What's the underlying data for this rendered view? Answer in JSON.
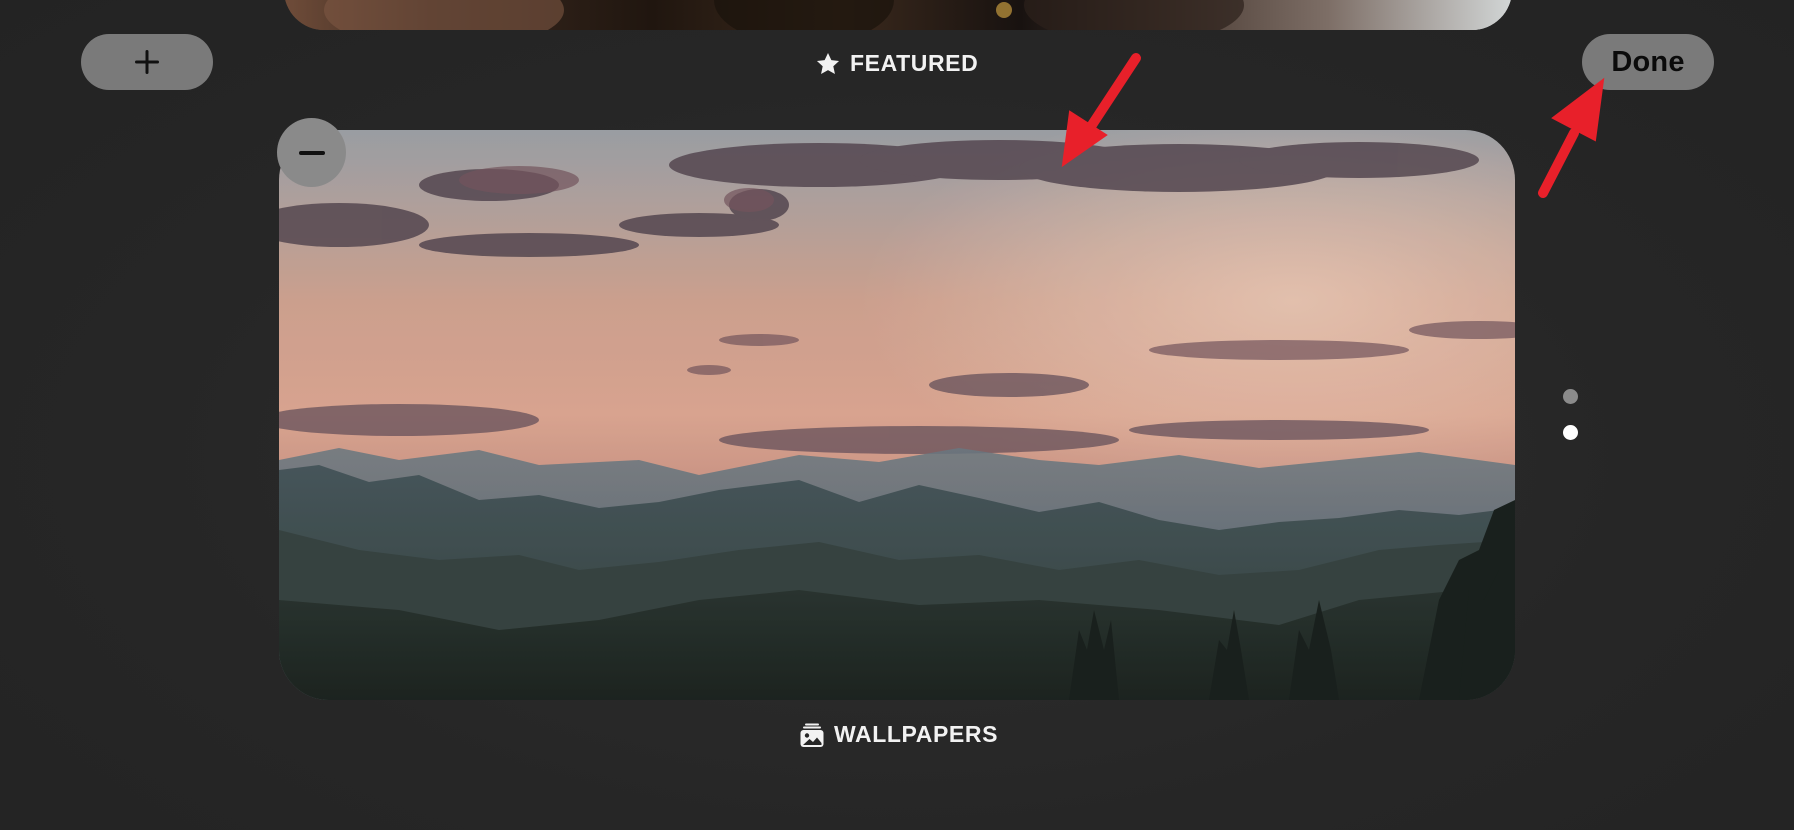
{
  "toolbar": {
    "add_label": "+",
    "done_label": "Done",
    "remove_label": "−"
  },
  "sections": {
    "featured": {
      "label": "FEATURED",
      "icon": "star-icon"
    },
    "wallpapers": {
      "label": "WALLPAPERS",
      "icon": "photo-stack-icon"
    }
  },
  "page_indicator": {
    "total": 2,
    "active": 2
  },
  "colors": {
    "background": "#262626",
    "pill": "#7a7a7a",
    "annotation_arrow": "#e8202a",
    "dot_inactive": "#8b8b8b",
    "dot_active": "#ffffff"
  }
}
